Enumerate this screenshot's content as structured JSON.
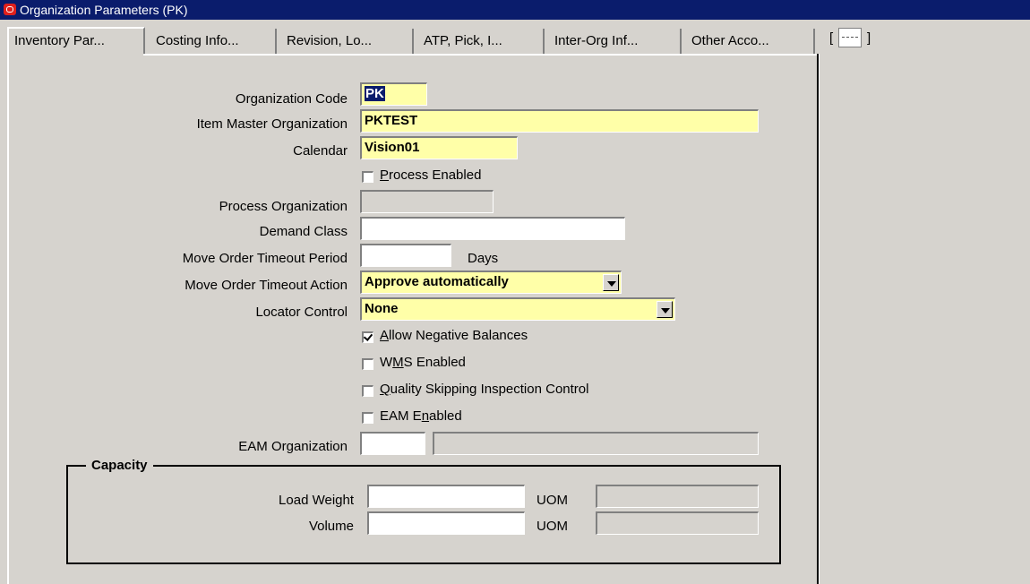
{
  "window": {
    "title": "Organization Parameters (PK)"
  },
  "tabs": [
    {
      "label": "Inventory Par..."
    },
    {
      "label": "Costing Info..."
    },
    {
      "label": "Revision, Lo..."
    },
    {
      "label": "ATP, Pick, I..."
    },
    {
      "label": "Inter-Org Inf..."
    },
    {
      "label": "Other Acco..."
    }
  ],
  "tab_overflow": {
    "open": "[",
    "close": "]"
  },
  "form": {
    "org_code": {
      "label": "Organization Code",
      "value": "PK"
    },
    "item_master": {
      "label": "Item Master Organization",
      "value": "PKTEST"
    },
    "calendar": {
      "label": "Calendar",
      "value": "Vision01"
    },
    "process_enabled": {
      "label_pre": "",
      "mnemonic": "P",
      "label_post": "rocess Enabled",
      "checked": false
    },
    "process_org": {
      "label": "Process Organization",
      "value": ""
    },
    "demand_class": {
      "label": "Demand Class",
      "value": ""
    },
    "move_timeout_period": {
      "label": "Move Order Timeout Period",
      "value": "",
      "unit": "Days"
    },
    "move_timeout_action": {
      "label": "Move Order Timeout Action",
      "value": "Approve automatically"
    },
    "locator_control": {
      "label": "Locator Control",
      "value": "None"
    },
    "allow_negative": {
      "label_pre": "",
      "mnemonic": "A",
      "label_post": "llow Negative Balances",
      "checked": true
    },
    "wms_enabled": {
      "label_pre": "W",
      "mnemonic": "M",
      "label_post": "S Enabled",
      "checked": false
    },
    "quality_skipping": {
      "label_pre": "",
      "mnemonic": "Q",
      "label_post": "uality Skipping Inspection Control",
      "checked": false
    },
    "eam_enabled": {
      "label_pre": "EAM E",
      "mnemonic": "n",
      "label_post": "abled",
      "checked": false
    },
    "eam_org": {
      "label": "EAM Organization",
      "value": "",
      "desc": ""
    }
  },
  "capacity": {
    "title": "Capacity",
    "load_weight": {
      "label": "Load Weight",
      "value": "",
      "uom_label": "UOM",
      "uom": ""
    },
    "volume": {
      "label": "Volume",
      "value": "",
      "uom_label": "UOM",
      "uom": ""
    }
  }
}
